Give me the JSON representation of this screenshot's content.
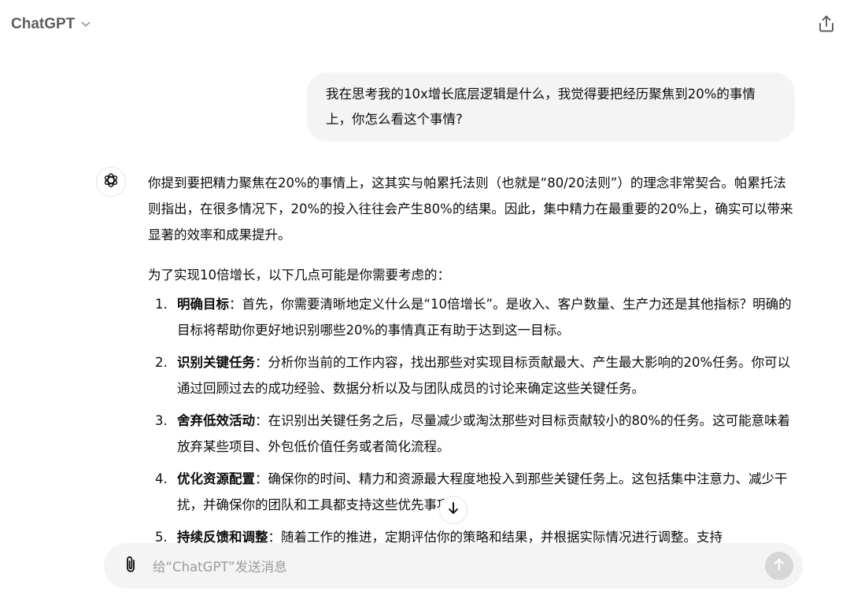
{
  "header": {
    "model_name": "ChatGPT",
    "model_icon": "chevron-down-icon",
    "share_icon": "share-icon"
  },
  "colors": {
    "user_bubble_bg": "#f4f4f4",
    "composer_bg": "#f4f4f4",
    "send_button_bg": "#d7d7d7",
    "text": "#0d0d0d"
  },
  "conversation": {
    "user_message": "我在思考我的10x增长底层逻辑是什么，我觉得要把经历聚焦到20%的事情上，你怎么看这个事情?",
    "assistant": {
      "avatar_icon": "openai-logo-icon",
      "intro_1": "你提到要把精力聚焦在20%的事情上，这其实与帕累托法则（也就是“80/20法则”）的理念非常契合。帕累托法则指出，在很多情况下，20%的投入往往会产生80%的结果。因此，集中精力在最重要的20%上，确实可以带来显著的效率和成果提升。",
      "intro_2": "为了实现10倍增长，以下几点可能是你需要考虑的：",
      "items": [
        {
          "number": "1.",
          "title": "明确目标",
          "text": "：首先，你需要清晰地定义什么是“10倍增长”。是收入、客户数量、生产力还是其他指标？明确的目标将帮助你更好地识别哪些20%的事情真正有助于达到这一目标。"
        },
        {
          "number": "2.",
          "title": "识别关键任务",
          "text": "：分析你当前的工作内容，找出那些对实现目标贡献最大、产生最大影响的20%任务。你可以通过回顾过去的成功经验、数据分析以及与团队成员的讨论来确定这些关键任务。"
        },
        {
          "number": "3.",
          "title": "舍弃低效活动",
          "text": "：在识别出关键任务之后，尽量减少或淘汰那些对目标贡献较小的80%的任务。这可能意味着放弃某些项目、外包低价值任务或者简化流程。"
        },
        {
          "number": "4.",
          "title": "优化资源配置",
          "text": "：确保你的时间、精力和资源最大程度地投入到那些关键任务上。这包括集中注意力、减少干扰，并确保你的团队和工具都支持这些优先事项。"
        },
        {
          "number": "5.",
          "title": "持续反馈和调整",
          "text": "：随着工作的推进，定期评估你的策略和结果，并根据实际情况进行调整。支持"
        }
      ]
    }
  },
  "composer": {
    "placeholder": "给“ChatGPT”发送消息",
    "value": "",
    "attach_icon": "paperclip-icon",
    "send_icon": "arrow-up-icon"
  },
  "scroll_button_icon": "arrow-down-icon"
}
